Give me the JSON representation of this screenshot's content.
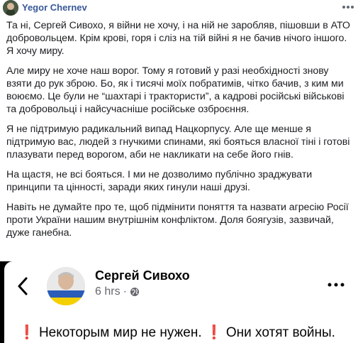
{
  "post": {
    "author": "Yegor Chernev",
    "paragraphs": [
      "Та ні, Сергей Сивохо, я війни не хочу, і на ній не заробляв, пішовши в АТО добровольцем. Крім крові, горя і сліз на тій війні я не бачив нічого іншого. Я хочу миру.",
      "Але миру не хоче наш ворог. Тому я готовий у разі необхідності знову взяти до рук зброю. Бо, як і тисячі моїх побратимів, чітко бачив, з ким ми воюємо. Це були не “шахтарі і трактористи”, а кадрові російські військові та добровольці і найсучасніше російське озброєння.",
      "Я не підтримую радикальний випад Нацкорпусу. Але ще менше я підтримую вас, людей з гнучкими спинами, які бояться власної тіні і готові плазувати перед ворогом, аби не накликати на себе його гнів.",
      "На щастя, не всі бояться. І ми не дозволимо публічно зраджувати принципи та цінності, заради яких гинули наші друзі.",
      "Навіть не думайте про те, щоб підмінити поняття та назвати агресію Росії проти України нашим внутрішнім конфліктом. Доля боягузів, зазвичай, дуже ганебна."
    ]
  },
  "shared": {
    "author": "Сергей Сивохо",
    "time": "6 hrs",
    "excl_mark": "❗",
    "text_part1": " Некоторым мир не нужен. ",
    "text_part2": " Они хотят войны."
  },
  "icons": {
    "more": "more-horizontal-icon",
    "back": "chevron-left-icon",
    "globe": "globe-icon"
  },
  "colors": {
    "author_link": "#385898",
    "exclamation": "#d31b1b",
    "meta_gray": "#65676b"
  }
}
